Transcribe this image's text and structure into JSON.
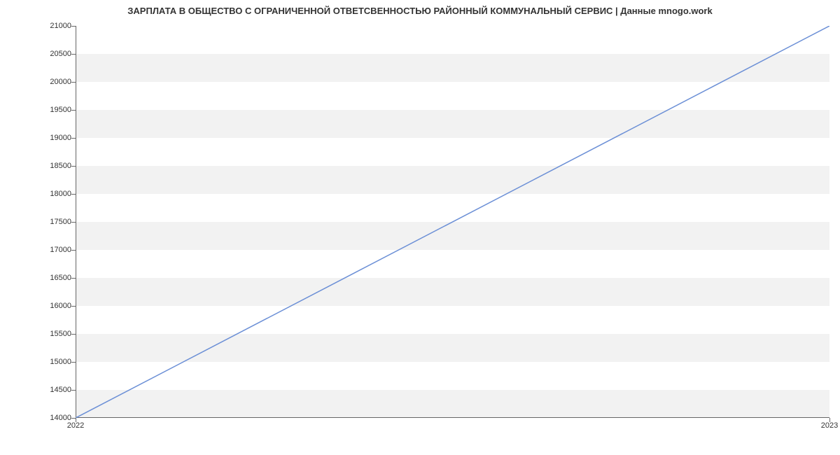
{
  "chart_data": {
    "type": "line",
    "title": "ЗАРПЛАТА В ОБЩЕСТВО С ОГРАНИЧЕННОЙ ОТВЕТСВЕННОСТЬЮ РАЙОННЫЙ КОММУНАЛЬНЫЙ СЕРВИС | Данные mnogo.work",
    "x": [
      "2022",
      "2023"
    ],
    "series": [
      {
        "name": "salary",
        "values": [
          14000,
          21000
        ],
        "color": "#6b8fd6"
      }
    ],
    "xlabel": "",
    "ylabel": "",
    "ylim": [
      14000,
      21000
    ],
    "y_ticks": [
      14000,
      14500,
      15000,
      15500,
      16000,
      16500,
      17000,
      17500,
      18000,
      18500,
      19000,
      19500,
      20000,
      20500,
      21000
    ],
    "x_ticks": [
      "2022",
      "2023"
    ]
  }
}
